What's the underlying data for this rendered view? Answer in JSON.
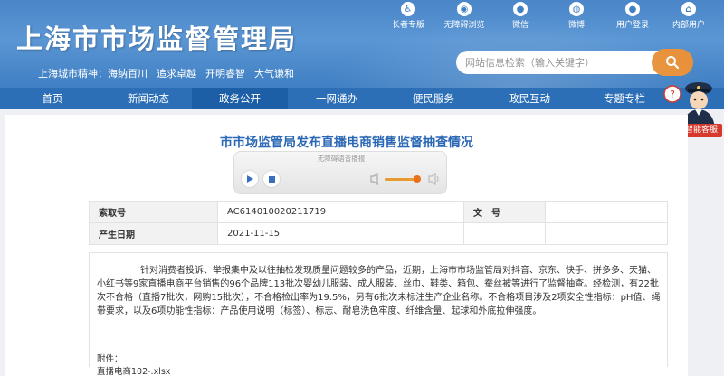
{
  "header": {
    "site_title": "上海市市场监督管理局",
    "city_spirit_label": "上海城市精神：",
    "city_spirit": [
      "海纳百川",
      "追求卓越",
      "开明睿智",
      "大气谦和"
    ],
    "top_links": [
      {
        "label": "长者专版",
        "icon": "elder-icon"
      },
      {
        "label": "无障碍浏览",
        "icon": "accessibility-icon"
      },
      {
        "label": "微信",
        "icon": "wechat-icon"
      },
      {
        "label": "微博",
        "icon": "weibo-icon"
      },
      {
        "label": "用户登录",
        "icon": "user-icon"
      },
      {
        "label": "内部用户",
        "icon": "internal-user-icon"
      }
    ],
    "search_placeholder": "网站信息检索（输入关键字）"
  },
  "nav": {
    "items": [
      "首页",
      "新闻动态",
      "政务公开",
      "一网通办",
      "便民服务",
      "政民互动",
      "专题专栏"
    ],
    "active": "政务公开"
  },
  "assistant": {
    "label": "智能客服"
  },
  "article": {
    "title": "市市场监管局发布直播电商销售监督抽查情况",
    "player_label": "无障碍语音播报",
    "meta": {
      "index_label": "索取号",
      "index_value": "AC614010020211719",
      "doc_label": "文　号",
      "doc_value": "",
      "date_label": "产生日期",
      "date_value": "2021-11-15"
    },
    "body": "针对消费者投诉、举报集中及以往抽检发现质量问题较多的产品，近期，上海市市场监管局对抖音、京东、快手、拼多多、天猫、小红书等9家直播电商平台销售的96个品牌113批次婴幼儿服装、成人服装、丝巾、鞋类、箱包、蚕丝被等进行了监督抽查。经检测，有22批次不合格（直播7批次，网购15批次），不合格检出率为19.5%，另有6批次未标注生产企业名称。不合格项目涉及2项安全性指标：pH值、绳带要求，以及6项功能性指标：产品使用说明（标签）、标志、耐皂洗色牢度、纤维含量、起球和外底拉伸强度。",
    "attachment_label": "附件：",
    "attachment_file": "直播电商102-.xlsx"
  },
  "colors": {
    "header_blue": "#4a86c8",
    "nav_blue": "#2c6fb7",
    "nav_active": "#1d5fa6",
    "title_blue": "#2a67b5",
    "search_orange": "#e8913a",
    "service_red": "#d63a2e"
  }
}
